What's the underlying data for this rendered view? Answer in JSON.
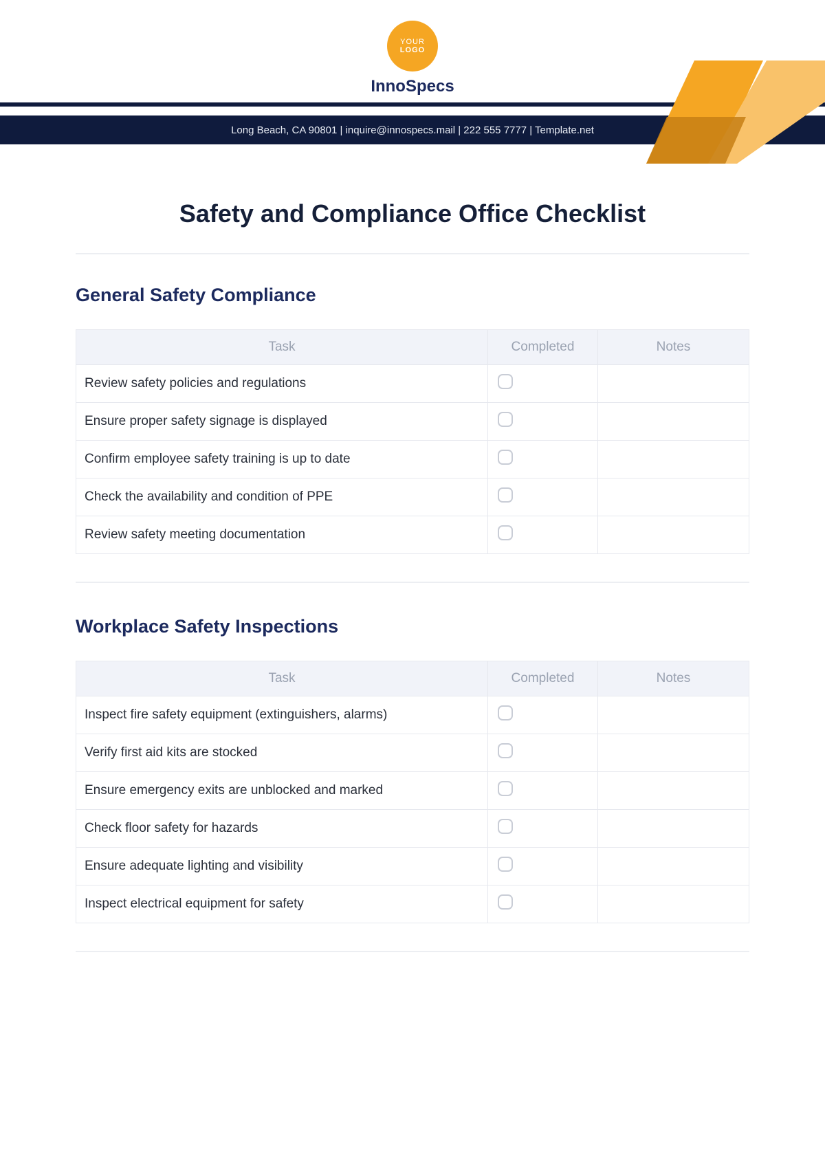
{
  "header": {
    "logo_line1": "YOUR",
    "logo_line2": "LOGO",
    "company": "InnoSpecs",
    "contact_line": "Long Beach, CA 90801 | inquire@innospecs.mail | 222 555 7777 | Template.net"
  },
  "page_title": "Safety and Compliance Office Checklist",
  "columns": {
    "task": "Task",
    "completed": "Completed",
    "notes": "Notes"
  },
  "sections": [
    {
      "title": "General Safety Compliance",
      "tasks": [
        "Review safety policies and regulations",
        "Ensure proper safety signage is displayed",
        "Confirm employee safety training is up to date",
        "Check the availability and condition of PPE",
        "Review safety meeting documentation"
      ]
    },
    {
      "title": "Workplace Safety Inspections",
      "tasks": [
        "Inspect fire safety equipment (extinguishers, alarms)",
        "Verify first aid kits are stocked",
        "Ensure emergency exits are unblocked and marked",
        "Check floor safety for hazards",
        "Ensure adequate lighting and visibility",
        "Inspect electrical equipment for safety"
      ]
    }
  ]
}
